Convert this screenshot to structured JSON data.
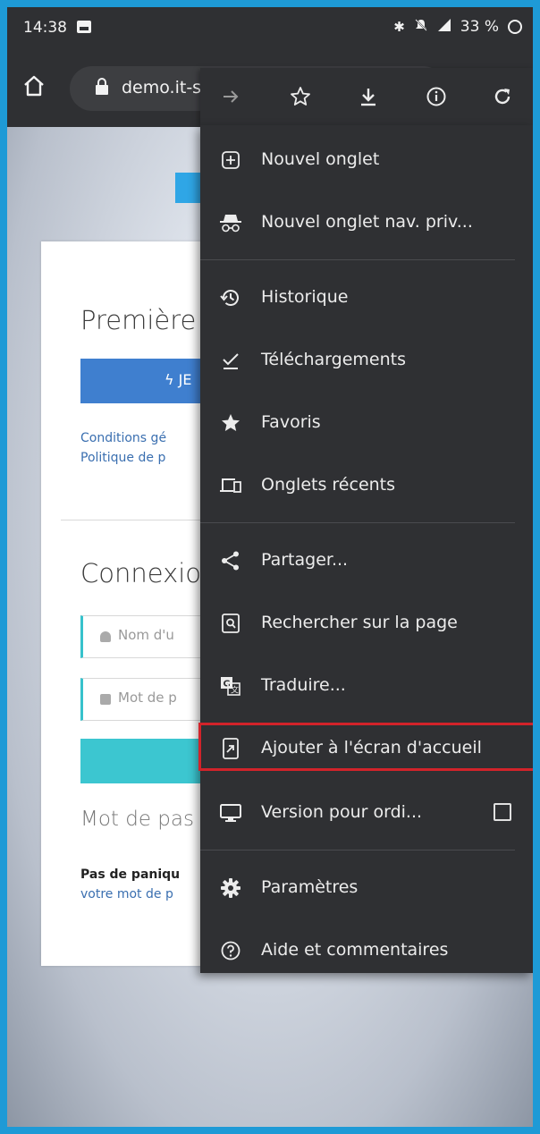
{
  "status_bar": {
    "time": "14:38",
    "battery": "33 %",
    "icons": [
      "image-icon",
      "bluetooth-icon",
      "mute-icon",
      "signal-icon",
      "battery-icon"
    ]
  },
  "toolbar": {
    "url": "demo.it-s",
    "actions": [
      "forward-icon",
      "bookmark-star-icon",
      "download-icon",
      "info-icon",
      "reload-icon"
    ]
  },
  "web_page": {
    "heading_first": "Première",
    "join_button": "ϟ JE",
    "link_terms": "Conditions gé",
    "link_policy": "Politique de p",
    "heading_login": "Connexio",
    "username_placeholder": "Nom d'u",
    "password_placeholder": "Mot de p",
    "forgot_heading": "Mot de pas",
    "panic_text": "Pas de paniqu",
    "panic_link": "votre mot de p"
  },
  "menu": {
    "items": [
      {
        "label": "Nouvel onglet",
        "icon": "plus-box-icon"
      },
      {
        "label": "Nouvel onglet nav. priv...",
        "icon": "incognito-icon"
      },
      {
        "label": "Historique",
        "icon": "history-icon"
      },
      {
        "label": "Téléchargements",
        "icon": "downloads-icon"
      },
      {
        "label": "Favoris",
        "icon": "star-icon"
      },
      {
        "label": "Onglets récents",
        "icon": "devices-icon"
      },
      {
        "label": "Partager...",
        "icon": "share-icon"
      },
      {
        "label": "Rechercher sur la page",
        "icon": "find-in-page-icon"
      },
      {
        "label": "Traduire...",
        "icon": "translate-icon"
      },
      {
        "label": "Ajouter à l'écran d'accueil",
        "icon": "add-to-home-icon"
      },
      {
        "label": "Version pour ordi...",
        "icon": "desktop-icon"
      },
      {
        "label": "Paramètres",
        "icon": "gear-icon"
      },
      {
        "label": "Aide et commentaires",
        "icon": "help-icon"
      }
    ],
    "highlighted_item": "Ajouter à l'écran d'accueil",
    "desktop_checkbox_checked": false
  },
  "colors": {
    "frame": "#1e9ad6",
    "menu_bg": "#2f3033",
    "highlight": "#d2232a"
  }
}
